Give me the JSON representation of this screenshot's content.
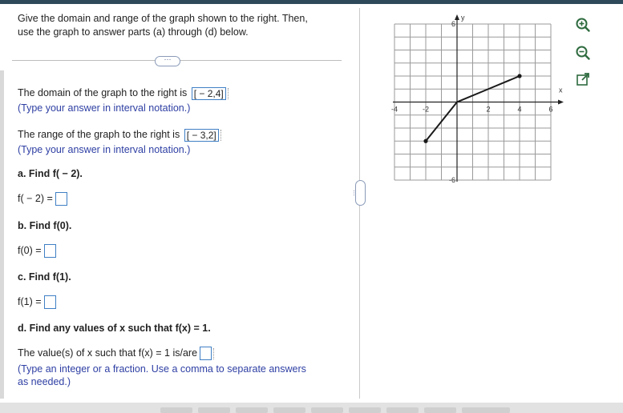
{
  "question": {
    "intro_line1": "Give the domain and range of the graph shown to the right. Then,",
    "intro_line2": "use the graph to answer parts (a) through (d) below.",
    "expander_dots": "···"
  },
  "domain": {
    "prompt": "The domain of the graph to the right is",
    "answer": "[ − 2,4]",
    "hint": "(Type your answer in interval notation.)"
  },
  "range": {
    "prompt": "The range of the graph to the right is",
    "answer": "[ − 3,2]",
    "hint": "(Type your answer in interval notation.)"
  },
  "part_a": {
    "label": "a. Find f( − 2).",
    "lhs": "f( − 2) ="
  },
  "part_b": {
    "label": "b. Find f(0).",
    "lhs": "f(0) ="
  },
  "part_c": {
    "label": "c. Find f(1).",
    "lhs": "f(1) ="
  },
  "part_d": {
    "label": "d. Find any values of x such that f(x) = 1.",
    "prompt": "The value(s) of x such that f(x) = 1 is/are",
    "hint_line1": "(Type an integer or a fraction. Use a comma to separate answers",
    "hint_line2": "as needed.)"
  },
  "graph": {
    "x_axis_label": "x",
    "y_axis_label": "y",
    "x_tick_labels": [
      "-4",
      "-2",
      "2",
      "4",
      "6"
    ],
    "y_tick_labels": [
      "6",
      "-6"
    ],
    "xlim": [
      -4,
      6
    ],
    "ylim": [
      -6,
      6
    ],
    "segment_points": [
      [
        -2,
        -3
      ],
      [
        0,
        0
      ],
      [
        2,
        1
      ],
      [
        4,
        2
      ]
    ],
    "line_color": "#1a1a1a"
  },
  "toolbar_icons": [
    "zoom-in-icon",
    "zoom-out-icon",
    "popout-icon"
  ],
  "colors": {
    "accent": "#3f7fc4",
    "hint_text": "#2e3fa3",
    "top_bar": "#2e4a5a"
  }
}
